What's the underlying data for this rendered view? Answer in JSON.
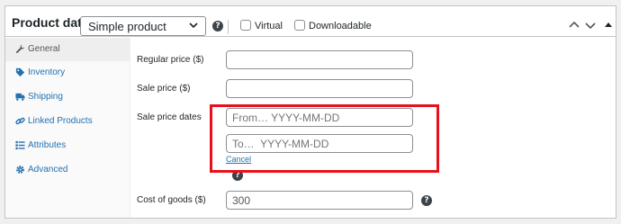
{
  "header": {
    "title": "Product data —",
    "product_type": "Simple product",
    "help": "?",
    "virtual_label": "Virtual",
    "downloadable_label": "Downloadable"
  },
  "sidebar": {
    "items": [
      {
        "label": "General",
        "icon": "wrench-icon",
        "active": true
      },
      {
        "label": "Inventory",
        "icon": "tag-icon"
      },
      {
        "label": "Shipping",
        "icon": "truck-icon"
      },
      {
        "label": "Linked Products",
        "icon": "link-icon"
      },
      {
        "label": "Attributes",
        "icon": "list-icon"
      },
      {
        "label": "Advanced",
        "icon": "gear-icon"
      }
    ]
  },
  "fields": {
    "regular_price_label": "Regular price ($)",
    "regular_price_value": "",
    "sale_price_label": "Sale price ($)",
    "sale_price_value": "",
    "sale_dates_label": "Sale price dates",
    "from_placeholder": "From… YYYY-MM-DD",
    "to_placeholder": "To…  YYYY-MM-DD",
    "cancel_label": "Cancel",
    "cost_label": "Cost of goods ($)",
    "cost_value": "300",
    "help": "?"
  },
  "colors": {
    "link": "#2271b1",
    "highlight": "#e8101a"
  }
}
